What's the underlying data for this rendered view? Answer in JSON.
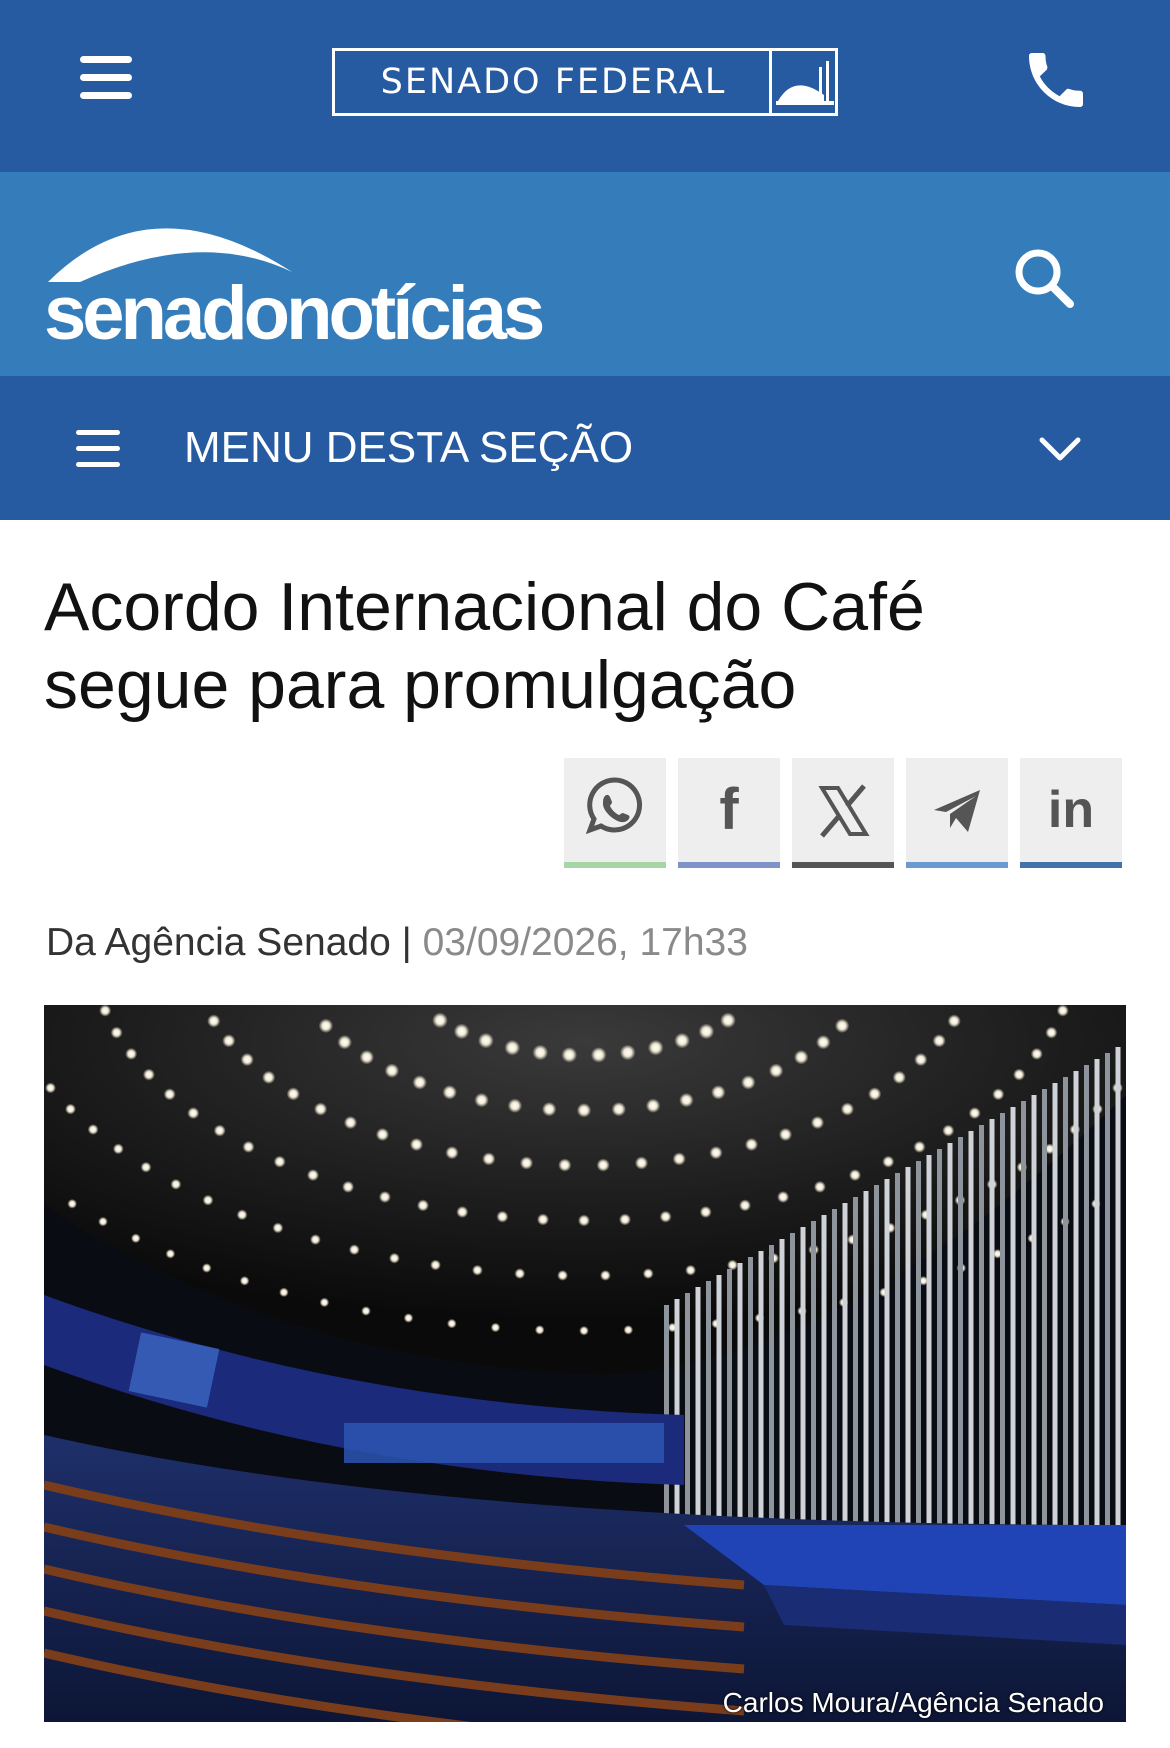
{
  "header": {
    "senado_federal_label": "SENADO FEDERAL",
    "menu_icon": "hamburger-icon",
    "phone_icon": "phone-icon",
    "background_color": "#275ba1"
  },
  "brand": {
    "logo_text": "senadonotícias",
    "search_icon": "search-icon",
    "background_color": "#357dba"
  },
  "section_menu": {
    "label": "MENU DESTA SEÇÃO",
    "expand_icon": "chevron-down-icon"
  },
  "article": {
    "title": "Acordo Internacional do Café segue para promulgação",
    "source": "Da Agência Senado",
    "separator": "|",
    "date": "03/09/2026, 17h33",
    "photo_credit": "Carlos Moura/Agência Senado"
  },
  "share_buttons": [
    {
      "name": "whatsapp",
      "icon": "whatsapp-icon",
      "accent": "#a6d5a6"
    },
    {
      "name": "facebook",
      "icon": "facebook-icon",
      "label": "f",
      "accent": "#7f93c8"
    },
    {
      "name": "x",
      "icon": "x-icon",
      "accent": "#555555"
    },
    {
      "name": "telegram",
      "icon": "telegram-icon",
      "accent": "#6a9ad0"
    },
    {
      "name": "linkedin",
      "icon": "linkedin-icon",
      "label": "in",
      "accent": "#4372ab"
    }
  ]
}
